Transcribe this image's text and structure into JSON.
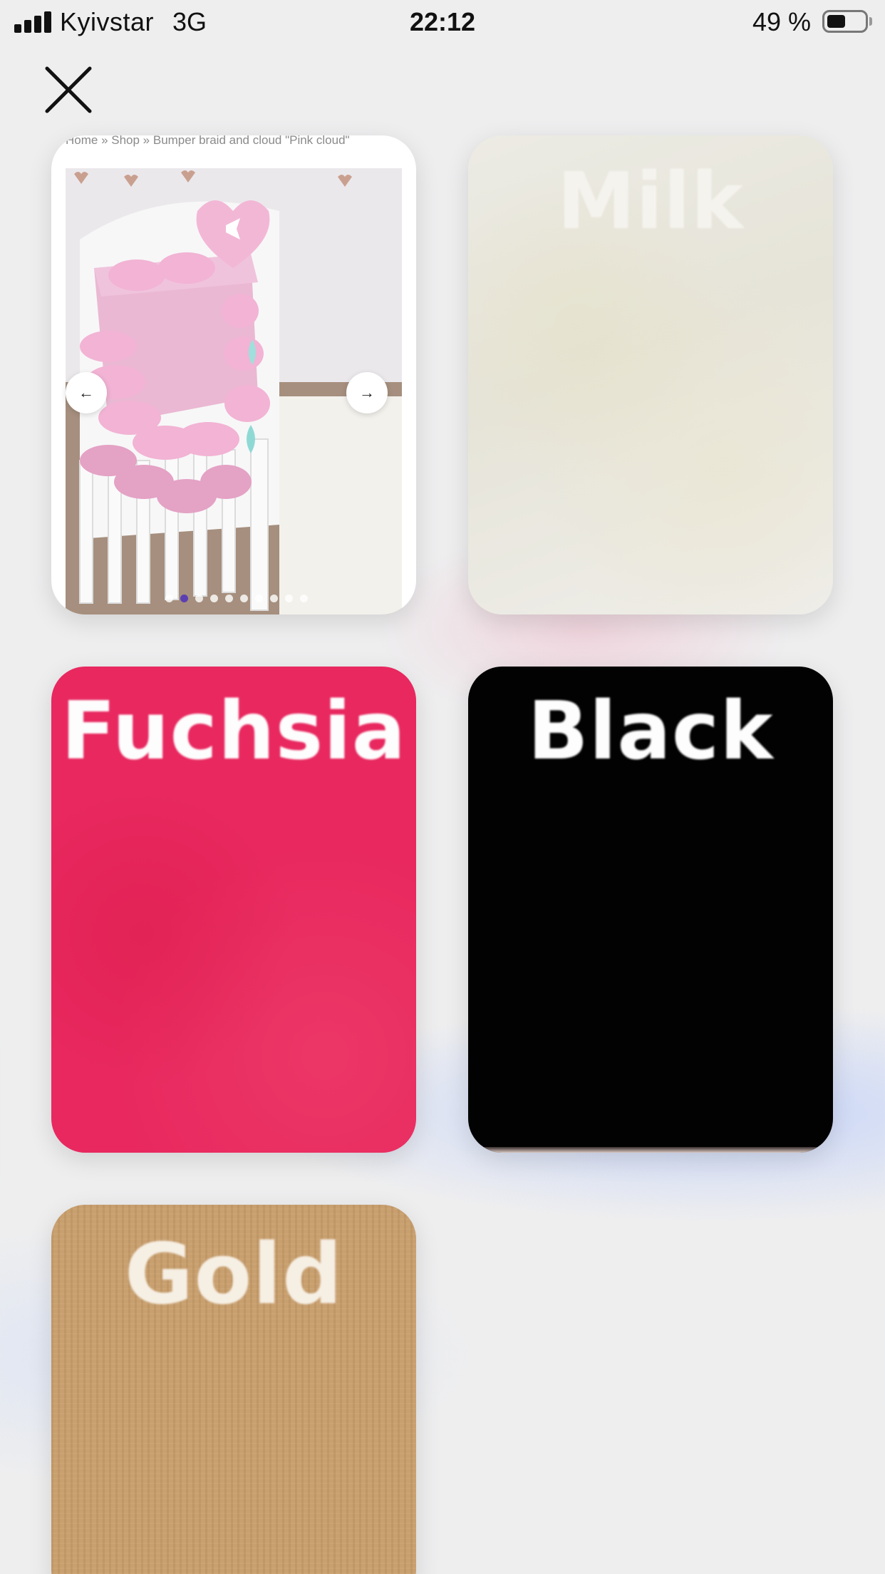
{
  "status_bar": {
    "carrier": "Kyivstar",
    "network": "3G",
    "time": "22:12",
    "battery_percent": "49 %",
    "battery_level": 0.49,
    "signal_bars": 4
  },
  "close_icon": "close-icon",
  "product": {
    "breadcrumb": "Home » Shop » Bumper braid and cloud \"Pink cloud\"",
    "prev_arrow": "←",
    "next_arrow": "→",
    "slide_count": 10,
    "active_slide": 2
  },
  "swatches": [
    {
      "label": "Milk",
      "color": "#e9e7dc"
    },
    {
      "label": "Fuchsia",
      "color": "#e8285f"
    },
    {
      "label": "Black",
      "color": "#020202"
    },
    {
      "label": "Gold",
      "color": "#c89f6f"
    }
  ]
}
